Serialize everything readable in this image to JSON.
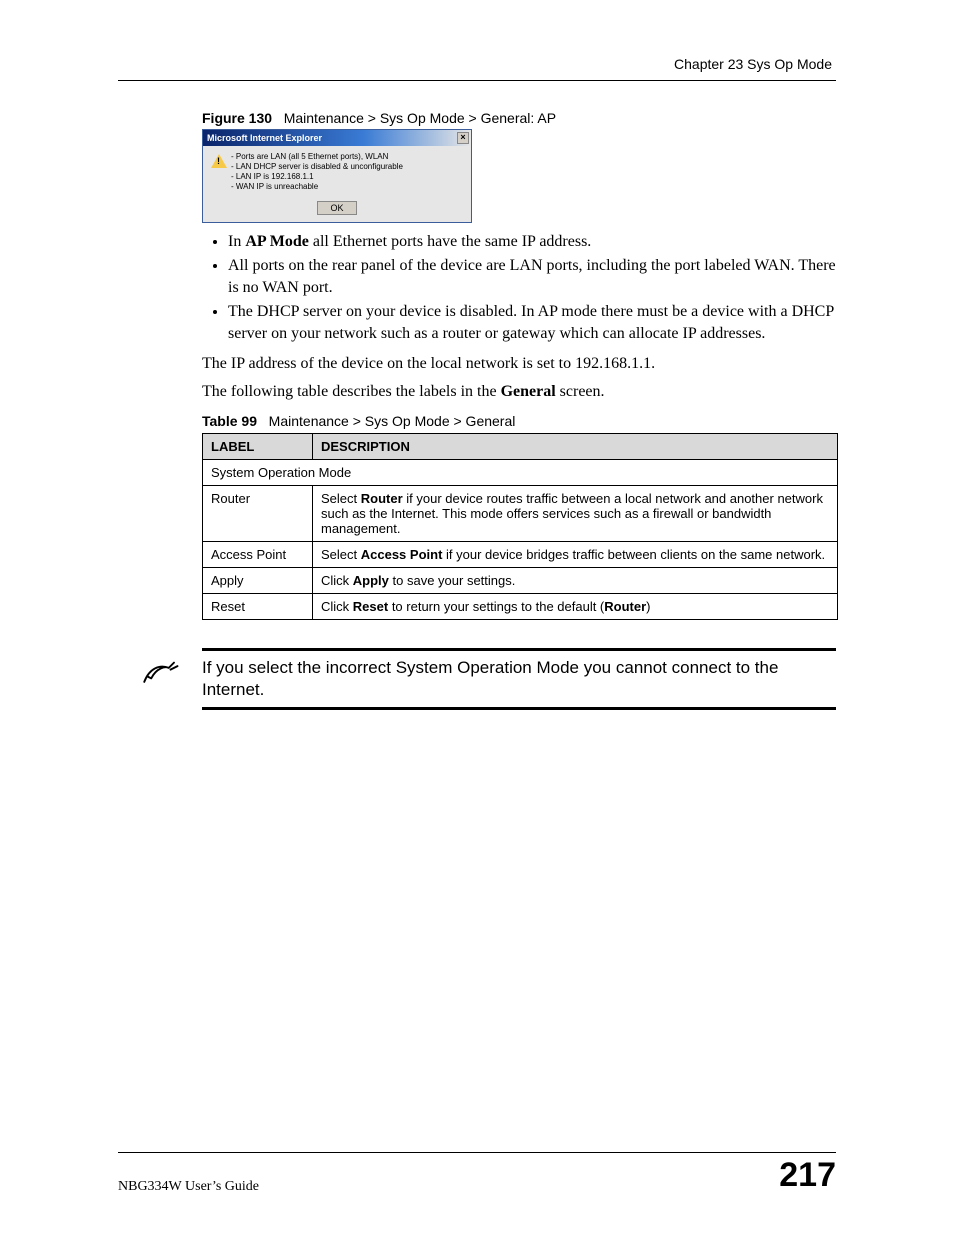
{
  "header": {
    "chapter": "Chapter 23 Sys Op Mode"
  },
  "figure": {
    "label": "Figure 130",
    "caption": "Maintenance > Sys Op Mode > General: AP",
    "dialog": {
      "title": "Microsoft Internet Explorer",
      "lines": [
        "- Ports are LAN (all 5 Ethernet ports), WLAN",
        "- LAN DHCP server is disabled & unconfigurable",
        "- LAN IP is 192.168.1.1",
        "- WAN IP is unreachable"
      ],
      "ok": "OK"
    }
  },
  "bullets": [
    {
      "pre": "In ",
      "bold": "AP Mode",
      "post": " all Ethernet ports have the same IP address."
    },
    {
      "pre": "",
      "bold": "",
      "post": "All ports on the rear panel of the device are LAN ports, including the port labeled WAN. There is no WAN port."
    },
    {
      "pre": "",
      "bold": "",
      "post": "The DHCP server on your device is disabled. In AP mode there must be a device with a DHCP server on your network such as a router or gateway which can allocate IP addresses."
    }
  ],
  "para1": "The IP address of the device on the local network is set to 192.168.1.1.",
  "para2_pre": "The following table describes the labels in the ",
  "para2_bold": "General",
  "para2_post": " screen.",
  "table": {
    "label": "Table 99",
    "caption": "Maintenance > Sys Op Mode > General",
    "head": {
      "c1": "LABEL",
      "c2": "DESCRIPTION"
    },
    "section": "System Operation Mode",
    "rows": [
      {
        "label": "Router",
        "d_pre": "Select ",
        "d_b1": "Router",
        "d_post": " if your device routes traffic between a local network and another network such as the Internet. This mode offers services such as a firewall or bandwidth management."
      },
      {
        "label": "Access Point",
        "d_pre": "Select ",
        "d_b1": "Access Point",
        "d_post": " if your device bridges traffic between clients on the same network."
      },
      {
        "label": "Apply",
        "d_pre": "Click ",
        "d_b1": "Apply",
        "d_post": " to save your settings."
      },
      {
        "label": "Reset",
        "d_pre": "Click ",
        "d_b1": "Reset",
        "d_mid": " to return your settings to the default (",
        "d_b2": "Router",
        "d_post2": ")"
      }
    ]
  },
  "note": "If you select the incorrect System Operation Mode you cannot connect to the Internet.",
  "footer": {
    "guide": "NBG334W User’s Guide",
    "page": "217"
  }
}
